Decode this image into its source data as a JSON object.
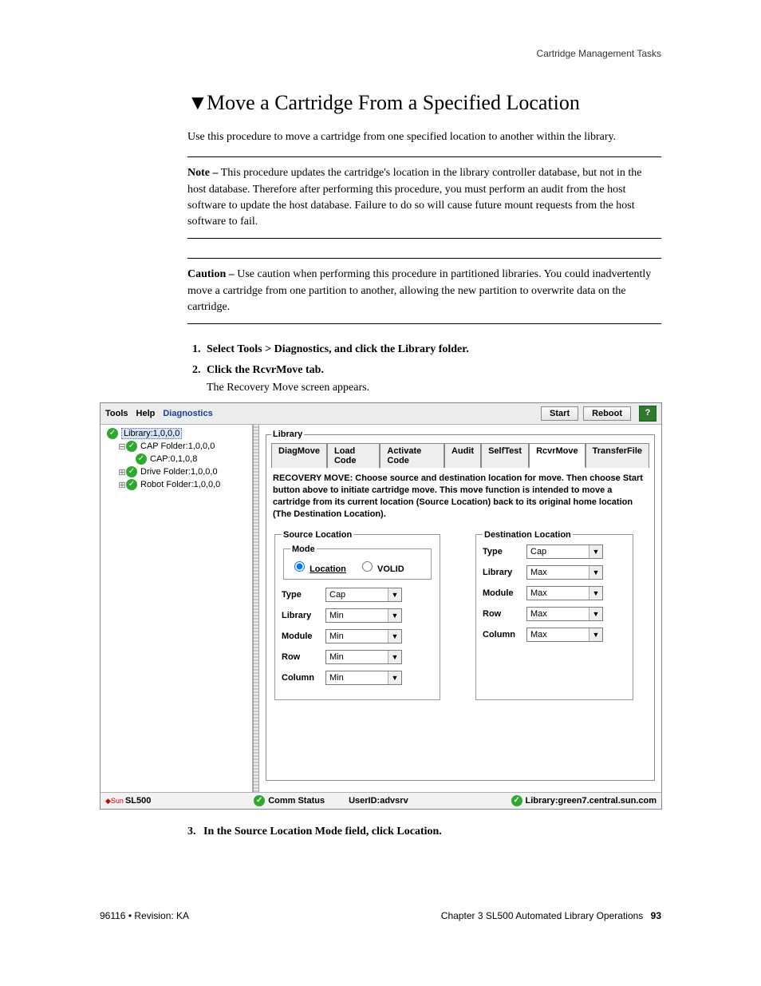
{
  "running_header": "Cartridge Management Tasks",
  "section_marker": "▼",
  "section_title": "Move a Cartridge From a Specified Location",
  "intro": "Use this procedure to move a cartridge from one specified location to another within the library.",
  "note_label": "Note –",
  "note_text": " This procedure updates the cartridge's location in the library controller database, but not in the host database. Therefore after performing this procedure, you must perform an audit from the host software to update the host database. Failure to do so will cause future mount requests from the host software to fail.",
  "caution_label": "Caution –",
  "caution_text": " Use caution when performing this procedure in partitioned libraries. You could inadvertently move a cartridge from one partition to another, allowing the new partition to overwrite data on the cartridge.",
  "steps": {
    "s1": "Select Tools > Diagnostics, and click the Library folder.",
    "s2": "Click the RcvrMove tab.",
    "s2_follow": "The Recovery Move screen appears.",
    "s3_num": "3.",
    "s3": "In the Source Location Mode field, click Location."
  },
  "app": {
    "menu": {
      "tools": "Tools",
      "help": "Help",
      "diagnostics": "Diagnostics"
    },
    "buttons": {
      "start": "Start",
      "reboot": "Reboot",
      "help": "?"
    },
    "tree": {
      "library": "Library:1,0,0,0",
      "capfolder": "CAP Folder:1,0,0,0",
      "cap": "CAP:0,1,0,8",
      "drivefolder": "Drive Folder:1,0,0,0",
      "robotfolder": "Robot Folder:1,0,0,0"
    },
    "panel_legend": "Library",
    "tabs": {
      "diagmove": "DiagMove",
      "loadcode": "Load Code",
      "activatecode": "Activate Code",
      "audit": "Audit",
      "selftest": "SelfTest",
      "rcvrmove": "RcvrMove",
      "transferfile": "TransferFile"
    },
    "instructions": "RECOVERY MOVE: Choose source and destination location for move. Then choose Start button above to initiate cartridge move. This move function is intended to move a cartridge from its current location (Source Location) back to its original home location (The Destination Location).",
    "source": {
      "legend": "Source Location",
      "mode_legend": "Mode",
      "radio_location": "Location",
      "radio_volid": "VOLID",
      "type_l": "Type",
      "type_v": "Cap",
      "library_l": "Library",
      "library_v": "Min",
      "module_l": "Module",
      "module_v": "Min",
      "row_l": "Row",
      "row_v": "Min",
      "column_l": "Column",
      "column_v": "Min"
    },
    "dest": {
      "legend": "Destination Location",
      "type_l": "Type",
      "type_v": "Cap",
      "library_l": "Library",
      "library_v": "Max",
      "module_l": "Module",
      "module_v": "Max",
      "row_l": "Row",
      "row_v": "Max",
      "column_l": "Column",
      "column_v": "Max"
    },
    "status": {
      "product": "SL500",
      "comm": "Comm Status",
      "userid_label": "UserID: ",
      "userid": "advsrv",
      "library_label": "Library:",
      "library_host": "green7.central.sun.com"
    }
  },
  "footer": {
    "left": "96116 • Revision: KA",
    "right_a": "Chapter 3 SL500 Automated Library Operations",
    "right_page": "93"
  }
}
